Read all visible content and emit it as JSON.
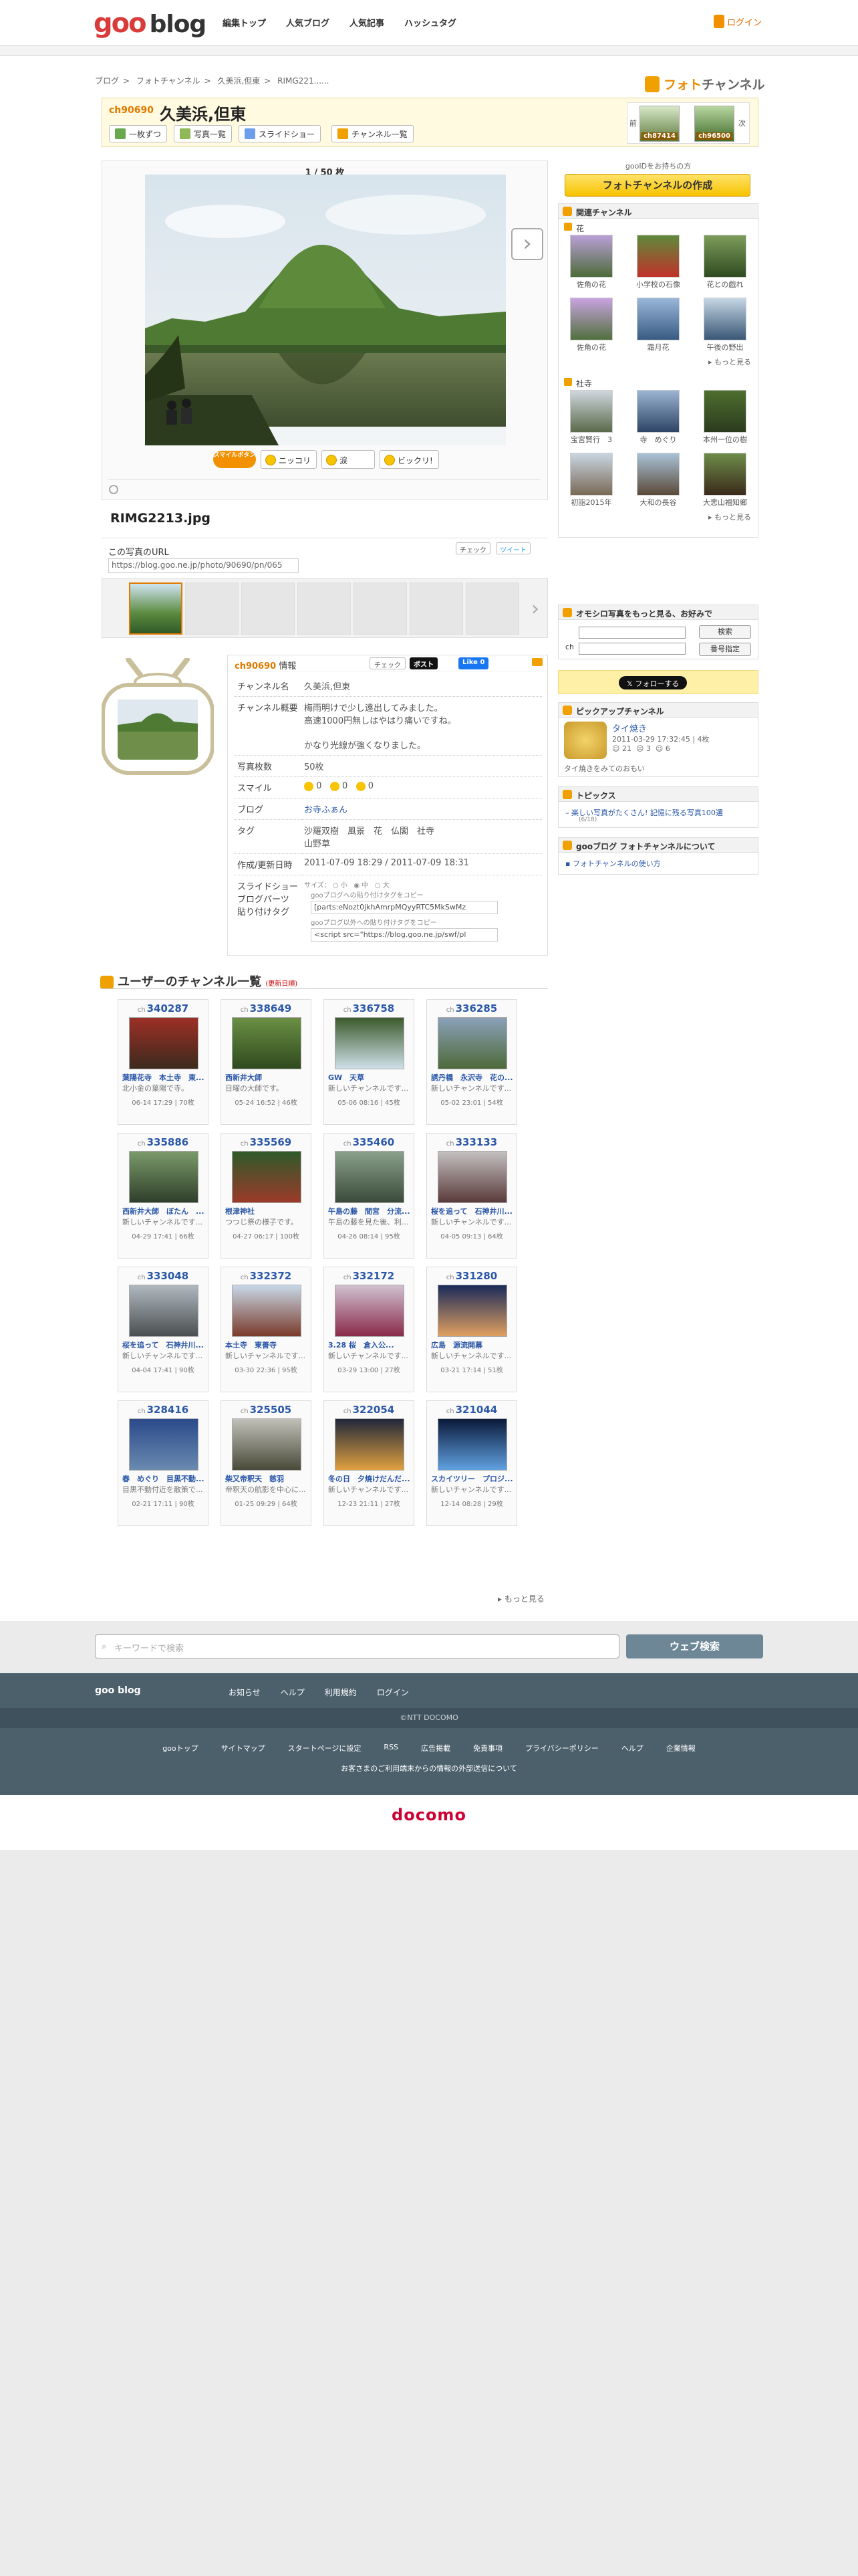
{
  "header": {
    "logo_goo": "goo",
    "logo_blog": "blog",
    "nav": [
      "編集トップ",
      "人気ブログ",
      "人気記事",
      "ハッシュタグ"
    ],
    "login": "ログイン"
  },
  "breadcrumb": [
    "ブログ",
    ">",
    "フォトチャンネル",
    ">",
    "久美浜,但東",
    ">",
    "RIMG221......"
  ],
  "fc_logo": {
    "a": "フォト",
    "b": "チャンネル"
  },
  "channel": {
    "number": "ch90690",
    "title": "久美浜,但東",
    "buttons": [
      "一枚ずつ",
      "写真一覧",
      "スライドショー",
      "チャンネル一覧"
    ],
    "prev_label": "ch87414",
    "next_label": "ch96500",
    "prev_arrow": "前",
    "next_arrow": "次"
  },
  "photo": {
    "counter": "1 / 50 枚",
    "smile_badge": "スマイルボタン",
    "reactions": [
      "ニッコリ",
      "涙",
      "ビックリ!"
    ],
    "filename": "RIMG2213.jpg",
    "url_label": "この写真のURL",
    "url": "https://blog.goo.ne.jp/photo/90690/pn/065",
    "check_btn": "チェック",
    "tweet_btn": "ツイート"
  },
  "info": {
    "head_no": "ch90690",
    "head_suffix": " 情報",
    "check": "チェック",
    "post": "ポスト",
    "like": "Like 0",
    "rows": {
      "name_k": "チャンネル名",
      "name_v": "久美浜,但東",
      "desc_k": "チャンネル概要",
      "desc_1": "梅雨明けで少し遠出してみました。",
      "desc_2": "高速1000円無しはやはり痛いですね。",
      "desc_3": "かなり光線が強くなりました。",
      "count_k": "写真枚数",
      "count_v": "50枚",
      "smile_k": "スマイル",
      "smile_a": "0",
      "smile_b": "0",
      "smile_c": "0",
      "blog_k": "ブログ",
      "blog_v": "お寺ふぁん",
      "tag_k": "タグ",
      "tag_v": "沙羅双樹　風景　花　仏閣　社寺",
      "tag_v2": "山野草",
      "date_k": "作成/更新日時",
      "date_v": "2011-07-09 18:29 / 2011-07-09 18:31",
      "parts_k1": "スライドショー",
      "parts_k2": "ブログパーツ",
      "parts_k3": "貼り付けタグ",
      "size_label": "サイズ：",
      "size_opts": [
        "小",
        "中",
        "大"
      ],
      "code1_label": "gooブログへの貼り付けタグをコピー",
      "code1": "[parts:eNozt0jkhAmrpMQyyRTC5MkSwMz",
      "code2_label": "gooブログ以外への貼り付けタグをコピー",
      "code2": "<script src=\"https://blog.goo.ne.jp/swf/pl"
    }
  },
  "sidebar": {
    "count_text": "gooIDをお持ちの方",
    "make_btn": "フォトチャンネルの作成",
    "related_head": "関連チャンネル",
    "cat1": "花",
    "cat1_items": [
      "佐角の花",
      "小学校の石像",
      "花との戯れ",
      "佐角の花",
      "霜月花",
      "午後の野出"
    ],
    "cat2": "社寺",
    "cat2_items": [
      "宝宮賢行　3",
      "寺　めぐり",
      "本州一位の樹",
      "初詣2015年",
      "大和の長谷",
      "大悲山福知鄉"
    ],
    "more": "もっと見る",
    "recommend_head": "オモシロ写真をもっと見る、お好みで",
    "search_btn": "検索",
    "num_btn": "番号指定",
    "ch_label": "ch",
    "follow": "フォローする",
    "pickup_head": "ピックアップチャンネル",
    "pickup_title": "タイ焼き",
    "pickup_date": "2011-03-29 17:32:45 | 4枚",
    "pickup_s1": "21",
    "pickup_s2": "3",
    "pickup_s3": "6",
    "pickup_desc": "タイ焼きをみてのおもい",
    "topics_head": "トピックス",
    "topics_item": "楽しい写真がたくさん! 記憶に残る写真100選",
    "topics_date": "(6/18)",
    "about_head": "gooブログ フォトチャンネルについて",
    "about_item": "フォトチャンネルの使い方"
  },
  "userlist": {
    "title": "ユーザーのチャンネル一覧",
    "updated": "(更新日順)",
    "more": "もっと見る",
    "cards": [
      {
        "no": "340287",
        "t": "葉陽花寺　本土寺　東...",
        "d": "北小金の葉陽で寺。",
        "m": "06-14 17:29 | 70枚"
      },
      {
        "no": "338649",
        "t": "西新井大師",
        "d": "日曜の大師です。",
        "m": "05-24 16:52 | 46枚"
      },
      {
        "no": "336758",
        "t": "GW　天草",
        "d": "新しいチャンネルです...",
        "m": "05-06 08:16 | 45枚"
      },
      {
        "no": "336285",
        "t": "誘丹橋　永沢寺　花の...",
        "d": "新しいチャンネルです...",
        "m": "05-02 23:01 | 54枚"
      },
      {
        "no": "335886",
        "t": "西新井大師　ぼたん　...",
        "d": "新しいチャンネルです...",
        "m": "04-29 17:41 | 66枚"
      },
      {
        "no": "335569",
        "t": "根津神社",
        "d": "つつじ祭の様子です。",
        "m": "04-27 06:17 | 100枚"
      },
      {
        "no": "335460",
        "t": "午島の藤　間宮　分流...",
        "d": "午島の藤を見た後、利...",
        "m": "04-26 08:14 | 95枚"
      },
      {
        "no": "333133",
        "t": "桜を追って　石神井川...",
        "d": "新しいチャンネルです...",
        "m": "04-05 09:13 | 64枚"
      },
      {
        "no": "333048",
        "t": "桜を追って　石神井川...",
        "d": "新しいチャンネルです...",
        "m": "04-04 17:41 | 90枚"
      },
      {
        "no": "332372",
        "t": "本土寺　東善寺",
        "d": "新しいチャンネルです...",
        "m": "03-30 22:36 | 95枚"
      },
      {
        "no": "332172",
        "t": "3.28 桜　倉入公...",
        "d": "新しいチャンネルです...",
        "m": "03-29 13:00 | 27枚"
      },
      {
        "no": "331280",
        "t": "広島　源流開幕",
        "d": "新しいチャンネルです...",
        "m": "03-21 17:14 | 51枚"
      },
      {
        "no": "328416",
        "t": "春　めぐり　目黒不動...",
        "d": "目黒不動付近を散策で...",
        "m": "02-21 17:11 | 90枚"
      },
      {
        "no": "325505",
        "t": "柴又帝釈天　慈羽",
        "d": "帝釈天の航影を中心に...",
        "m": "01-25 09:29 | 64枚"
      },
      {
        "no": "322054",
        "t": "冬の日　夕焼けだんだ...",
        "d": "新しいチャンネルです...",
        "m": "12-23 21:11 | 27枚"
      },
      {
        "no": "321044",
        "t": "スカイツリー　プロジ...",
        "d": "新しいチャンネルです...",
        "m": "12-14 08:28 | 29枚"
      }
    ]
  },
  "footer": {
    "search_placeholder": "キーワードで検索",
    "search_btn": "ウェブ検索",
    "goo_blog": "goo blog",
    "nav": [
      "お知らせ",
      "ヘルプ",
      "利用規約",
      "ログイン"
    ],
    "copyright": "©NTT DOCOMO",
    "links": [
      "gooトップ",
      "サイトマップ",
      "スタートページに設定",
      "RSS",
      "広告掲載",
      "免責事項",
      "プライバシーポリシー",
      "ヘルプ",
      "企業情報"
    ],
    "note": "お客さまのご利用端末からの情報の外部送信について",
    "docomo": "docomo"
  },
  "colors": {
    "accent": "#f0a000",
    "link": "#2a57a8",
    "brand_red": "#d93a3a",
    "footer_bg": "#4c606c"
  }
}
